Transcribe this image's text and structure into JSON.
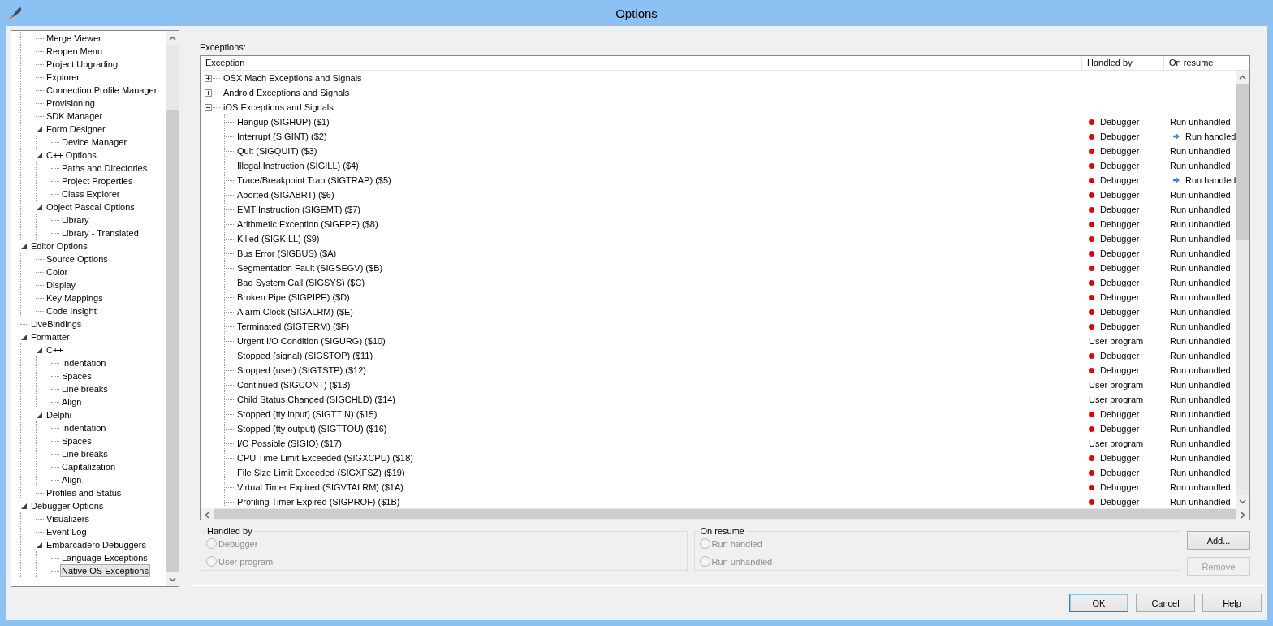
{
  "window": {
    "title": "Options"
  },
  "tree": {
    "items": [
      {
        "children": [
          {
            "label": "Merge Viewer",
            "selected": false
          },
          {
            "label": "Reopen Menu",
            "selected": false
          },
          {
            "label": "Project Upgrading",
            "selected": false
          },
          {
            "label": "Explorer",
            "selected": false
          },
          {
            "label": "Connection Profile Manager",
            "selected": false
          },
          {
            "label": "Provisioning",
            "selected": false
          },
          {
            "label": "SDK Manager",
            "selected": false
          },
          {
            "label": "Form Designer",
            "selected": false,
            "expanded": true,
            "children": [
              {
                "label": "Device Manager",
                "selected": false
              }
            ]
          },
          {
            "label": "C++ Options",
            "selected": false,
            "expanded": true,
            "children": [
              {
                "label": "Paths and Directories",
                "selected": false
              },
              {
                "label": "Project Properties",
                "selected": false
              },
              {
                "label": "Class Explorer",
                "selected": false
              }
            ]
          },
          {
            "label": "Object Pascal Options",
            "selected": false,
            "expanded": true,
            "children": [
              {
                "label": "Library",
                "selected": false
              },
              {
                "label": "Library - Translated",
                "selected": false
              }
            ]
          }
        ]
      },
      {
        "label": "Editor Options",
        "selected": false,
        "expanded": true,
        "children": [
          {
            "label": "Source Options",
            "selected": false
          },
          {
            "label": "Color",
            "selected": false
          },
          {
            "label": "Display",
            "selected": false
          },
          {
            "label": "Key Mappings",
            "selected": false
          },
          {
            "label": "Code Insight",
            "selected": false
          }
        ]
      },
      {
        "label": "LiveBindings",
        "selected": false
      },
      {
        "label": "Formatter",
        "selected": false,
        "expanded": true,
        "children": [
          {
            "label": "C++",
            "selected": false,
            "expanded": true,
            "children": [
              {
                "label": "Indentation",
                "selected": false
              },
              {
                "label": "Spaces",
                "selected": false
              },
              {
                "label": "Line breaks",
                "selected": false
              },
              {
                "label": "Align",
                "selected": false
              }
            ]
          },
          {
            "label": "Delphi",
            "selected": false,
            "expanded": true,
            "children": [
              {
                "label": "Indentation",
                "selected": false
              },
              {
                "label": "Spaces",
                "selected": false
              },
              {
                "label": "Line breaks",
                "selected": false
              },
              {
                "label": "Capitalization",
                "selected": false
              },
              {
                "label": "Align",
                "selected": false
              }
            ]
          },
          {
            "label": "Profiles and Status",
            "selected": false
          }
        ]
      },
      {
        "label": "Debugger Options",
        "selected": false,
        "expanded": true,
        "children": [
          {
            "label": "Visualizers",
            "selected": false
          },
          {
            "label": "Event Log",
            "selected": false
          },
          {
            "label": "Embarcadero Debuggers",
            "selected": false,
            "expanded": true,
            "children": [
              {
                "label": "Language Exceptions",
                "selected": false
              },
              {
                "label": "Native OS Exceptions",
                "selected": true
              }
            ]
          }
        ]
      }
    ]
  },
  "exceptions": {
    "label": "Exceptions:",
    "columns": [
      "Exception",
      "Handled by",
      "On resume"
    ],
    "groups": [
      {
        "name": "OSX Mach Exceptions and Signals",
        "expanded": false
      },
      {
        "name": "Android Exceptions and Signals",
        "expanded": false
      },
      {
        "name": "iOS Exceptions and Signals",
        "expanded": true,
        "children": [
          {
            "name": "Hangup (SIGHUP) ($1)",
            "handled_by": {
              "kind": "debugger",
              "text": "Debugger"
            },
            "on_resume": {
              "kind": "unhandled",
              "text": "Run unhandled"
            }
          },
          {
            "name": "Interrupt (SIGINT) ($2)",
            "handled_by": {
              "kind": "debugger",
              "text": "Debugger"
            },
            "on_resume": {
              "kind": "handled",
              "text": "Run handled"
            }
          },
          {
            "name": "Quit (SIGQUIT) ($3)",
            "handled_by": {
              "kind": "debugger",
              "text": "Debugger"
            },
            "on_resume": {
              "kind": "unhandled",
              "text": "Run unhandled"
            }
          },
          {
            "name": "Illegal Instruction (SIGILL) ($4)",
            "handled_by": {
              "kind": "debugger",
              "text": "Debugger"
            },
            "on_resume": {
              "kind": "unhandled",
              "text": "Run unhandled"
            }
          },
          {
            "name": "Trace/Breakpoint Trap (SIGTRAP) ($5)",
            "handled_by": {
              "kind": "debugger",
              "text": "Debugger"
            },
            "on_resume": {
              "kind": "handled",
              "text": "Run handled"
            }
          },
          {
            "name": "Aborted (SIGABRT) ($6)",
            "handled_by": {
              "kind": "debugger",
              "text": "Debugger"
            },
            "on_resume": {
              "kind": "unhandled",
              "text": "Run unhandled"
            }
          },
          {
            "name": "EMT Instruction (SIGEMT) ($7)",
            "handled_by": {
              "kind": "debugger",
              "text": "Debugger"
            },
            "on_resume": {
              "kind": "unhandled",
              "text": "Run unhandled"
            }
          },
          {
            "name": "Arithmetic Exception (SIGFPE) ($8)",
            "handled_by": {
              "kind": "debugger",
              "text": "Debugger"
            },
            "on_resume": {
              "kind": "unhandled",
              "text": "Run unhandled"
            }
          },
          {
            "name": "Killed (SIGKILL) ($9)",
            "handled_by": {
              "kind": "debugger",
              "text": "Debugger"
            },
            "on_resume": {
              "kind": "unhandled",
              "text": "Run unhandled"
            }
          },
          {
            "name": "Bus Error (SIGBUS) ($A)",
            "handled_by": {
              "kind": "debugger",
              "text": "Debugger"
            },
            "on_resume": {
              "kind": "unhandled",
              "text": "Run unhandled"
            }
          },
          {
            "name": "Segmentation Fault (SIGSEGV) ($B)",
            "handled_by": {
              "kind": "debugger",
              "text": "Debugger"
            },
            "on_resume": {
              "kind": "unhandled",
              "text": "Run unhandled"
            }
          },
          {
            "name": "Bad System Call (SIGSYS) ($C)",
            "handled_by": {
              "kind": "debugger",
              "text": "Debugger"
            },
            "on_resume": {
              "kind": "unhandled",
              "text": "Run unhandled"
            }
          },
          {
            "name": "Broken Pipe (SIGPIPE) ($D)",
            "handled_by": {
              "kind": "debugger",
              "text": "Debugger"
            },
            "on_resume": {
              "kind": "unhandled",
              "text": "Run unhandled"
            }
          },
          {
            "name": "Alarm Clock (SIGALRM) ($E)",
            "handled_by": {
              "kind": "debugger",
              "text": "Debugger"
            },
            "on_resume": {
              "kind": "unhandled",
              "text": "Run unhandled"
            }
          },
          {
            "name": "Terminated (SIGTERM) ($F)",
            "handled_by": {
              "kind": "debugger",
              "text": "Debugger"
            },
            "on_resume": {
              "kind": "unhandled",
              "text": "Run unhandled"
            }
          },
          {
            "name": "Urgent I/O Condition (SIGURG) ($10)",
            "handled_by": {
              "kind": "user",
              "text": "User program"
            },
            "on_resume": {
              "kind": "unhandled",
              "text": "Run unhandled"
            }
          },
          {
            "name": "Stopped (signal) (SIGSTOP) ($11)",
            "handled_by": {
              "kind": "debugger",
              "text": "Debugger"
            },
            "on_resume": {
              "kind": "unhandled",
              "text": "Run unhandled"
            }
          },
          {
            "name": "Stopped (user) (SIGTSTP) ($12)",
            "handled_by": {
              "kind": "debugger",
              "text": "Debugger"
            },
            "on_resume": {
              "kind": "unhandled",
              "text": "Run unhandled"
            }
          },
          {
            "name": "Continued (SIGCONT) ($13)",
            "handled_by": {
              "kind": "user",
              "text": "User program"
            },
            "on_resume": {
              "kind": "unhandled",
              "text": "Run unhandled"
            }
          },
          {
            "name": "Child Status Changed (SIGCHLD) ($14)",
            "handled_by": {
              "kind": "user",
              "text": "User program"
            },
            "on_resume": {
              "kind": "unhandled",
              "text": "Run unhandled"
            }
          },
          {
            "name": "Stopped (tty input) (SIGTTIN) ($15)",
            "handled_by": {
              "kind": "debugger",
              "text": "Debugger"
            },
            "on_resume": {
              "kind": "unhandled",
              "text": "Run unhandled"
            }
          },
          {
            "name": "Stopped (tty output) (SIGTTOU) ($16)",
            "handled_by": {
              "kind": "debugger",
              "text": "Debugger"
            },
            "on_resume": {
              "kind": "unhandled",
              "text": "Run unhandled"
            }
          },
          {
            "name": "I/O Possible (SIGIO) ($17)",
            "handled_by": {
              "kind": "user",
              "text": "User program"
            },
            "on_resume": {
              "kind": "unhandled",
              "text": "Run unhandled"
            }
          },
          {
            "name": "CPU Time Limit Exceeded (SIGXCPU) ($18)",
            "handled_by": {
              "kind": "debugger",
              "text": "Debugger"
            },
            "on_resume": {
              "kind": "unhandled",
              "text": "Run unhandled"
            }
          },
          {
            "name": "File Size Limit Exceeded (SIGXFSZ) ($19)",
            "handled_by": {
              "kind": "debugger",
              "text": "Debugger"
            },
            "on_resume": {
              "kind": "unhandled",
              "text": "Run unhandled"
            }
          },
          {
            "name": "Virtual Timer Expired (SIGVTALRM) ($1A)",
            "handled_by": {
              "kind": "debugger",
              "text": "Debugger"
            },
            "on_resume": {
              "kind": "unhandled",
              "text": "Run unhandled"
            }
          },
          {
            "name": "Profiling Timer Expired (SIGPROF) ($1B)",
            "handled_by": {
              "kind": "debugger",
              "text": "Debugger"
            },
            "on_resume": {
              "kind": "unhandled",
              "text": "Run unhandled"
            }
          }
        ]
      }
    ]
  },
  "handled_by_group": {
    "title": "Handled by",
    "options": [
      {
        "label": "Debugger",
        "selected": false,
        "disabled": true
      },
      {
        "label": "User program",
        "selected": false,
        "disabled": true
      }
    ]
  },
  "on_resume_group": {
    "title": "On resume",
    "options": [
      {
        "label": "Run handled",
        "selected": false,
        "disabled": true
      },
      {
        "label": "Run unhandled",
        "selected": false,
        "disabled": true
      }
    ]
  },
  "side_buttons": [
    {
      "label": "Add...",
      "disabled": false
    },
    {
      "label": "Remove",
      "disabled": true
    }
  ],
  "dialog_buttons": [
    {
      "label": "OK",
      "default": true
    },
    {
      "label": "Cancel",
      "default": false
    },
    {
      "label": "Help",
      "default": false
    }
  ]
}
